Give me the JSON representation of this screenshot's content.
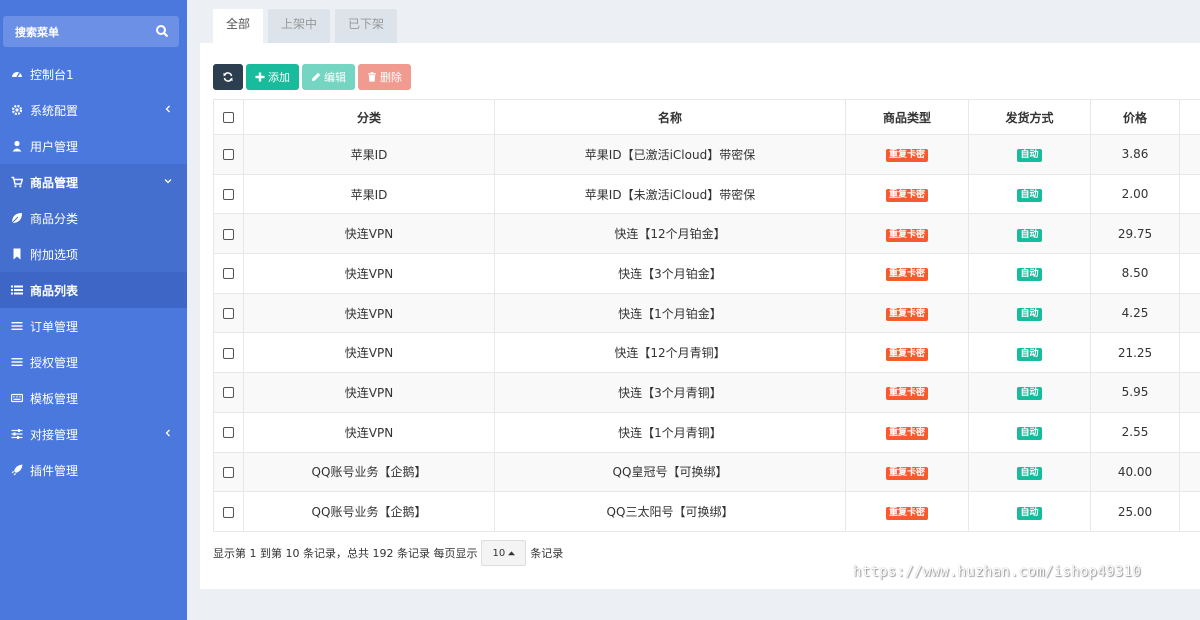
{
  "sidebar": {
    "search_label": "搜索菜单",
    "items": [
      {
        "label": "控制台1",
        "icon": "dashboard-icon"
      },
      {
        "label": "系统配置",
        "icon": "gear-icon"
      },
      {
        "label": "用户管理",
        "icon": "user-icon"
      },
      {
        "label": "商品管理",
        "icon": "cart-icon"
      },
      {
        "label": "商品分类",
        "icon": "leaf-icon"
      },
      {
        "label": "附加选项",
        "icon": "bookmark-icon"
      },
      {
        "label": "商品列表",
        "icon": "list-icon"
      },
      {
        "label": "订单管理",
        "icon": "bars-icon"
      },
      {
        "label": "授权管理",
        "icon": "bars-icon"
      },
      {
        "label": "模板管理",
        "icon": "keyboard-icon"
      },
      {
        "label": "对接管理",
        "icon": "sliders-icon"
      },
      {
        "label": "插件管理",
        "icon": "rocket-icon"
      }
    ]
  },
  "tabs": [
    "全部",
    "上架中",
    "已下架"
  ],
  "toolbar": {
    "add_label": "添加",
    "edit_label": "编辑",
    "delete_label": "删除"
  },
  "table": {
    "headers": [
      "分类",
      "名称",
      "商品类型",
      "发货方式",
      "价格"
    ],
    "rows": [
      {
        "category": "苹果ID",
        "name": "苹果ID【已激活iCloud】带密保",
        "type": "重复卡密",
        "delivery": "自动",
        "price": "3.86"
      },
      {
        "category": "苹果ID",
        "name": "苹果ID【未激活iCloud】带密保",
        "type": "重复卡密",
        "delivery": "自动",
        "price": "2.00"
      },
      {
        "category": "快连VPN",
        "name": "快连【12个月铂金】",
        "type": "重复卡密",
        "delivery": "自动",
        "price": "29.75"
      },
      {
        "category": "快连VPN",
        "name": "快连【3个月铂金】",
        "type": "重复卡密",
        "delivery": "自动",
        "price": "8.50"
      },
      {
        "category": "快连VPN",
        "name": "快连【1个月铂金】",
        "type": "重复卡密",
        "delivery": "自动",
        "price": "4.25"
      },
      {
        "category": "快连VPN",
        "name": "快连【12个月青铜】",
        "type": "重复卡密",
        "delivery": "自动",
        "price": "21.25"
      },
      {
        "category": "快连VPN",
        "name": "快连【3个月青铜】",
        "type": "重复卡密",
        "delivery": "自动",
        "price": "5.95"
      },
      {
        "category": "快连VPN",
        "name": "快连【1个月青铜】",
        "type": "重复卡密",
        "delivery": "自动",
        "price": "2.55"
      },
      {
        "category": "QQ账号业务【企鹅】",
        "name": "QQ皇冠号【可换绑】",
        "type": "重复卡密",
        "delivery": "自动",
        "price": "40.00"
      },
      {
        "category": "QQ账号业务【企鹅】",
        "name": "QQ三太阳号【可换绑】",
        "type": "重复卡密",
        "delivery": "自动",
        "price": "25.00"
      }
    ]
  },
  "pagination": {
    "summary": "显示第 1 到第 10 条记录，总共 192 条记录 每页显示",
    "page_size": "10",
    "suffix": "条记录"
  },
  "watermark": "https://www.huzhan.com/ishop49310",
  "colors": {
    "sidebar": "#4b78dd",
    "primary": "#2c3e50",
    "success": "#18bc9c",
    "danger": "#f75a2d"
  }
}
